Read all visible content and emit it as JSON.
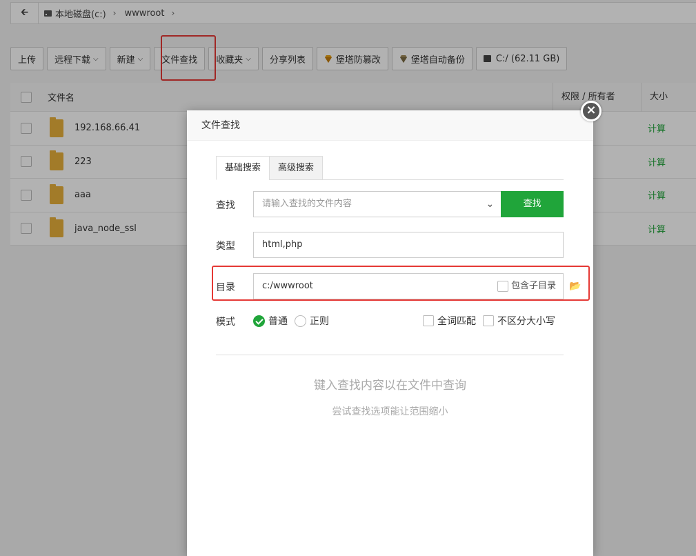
{
  "pathbar": {
    "back_icon": "arrow-left-icon",
    "crumbs": [
      "本地磁盘(c:)",
      "wwwroot"
    ]
  },
  "toolbar": {
    "upload": "上传",
    "remote_download": "远程下载",
    "new": "新建",
    "file_search": "文件查找",
    "favorites": "收藏夹",
    "share_list": "分享列表",
    "tamper_proof": "堡塔防篡改",
    "auto_backup": "堡塔自动备份",
    "disk": "C:/ (62.11 GB)"
  },
  "file_table": {
    "columns": {
      "name": "文件名",
      "perm": "权限 / 所有者",
      "size": "大小"
    },
    "rows": [
      {
        "name": "192.168.66.41",
        "size": "计算"
      },
      {
        "name": "223",
        "size": "计算"
      },
      {
        "name": "aaa",
        "size": "计算"
      },
      {
        "name": "java_node_ssl",
        "size": "计算"
      }
    ]
  },
  "dialog": {
    "title": "文件查找",
    "tabs": [
      "基础搜索",
      "高级搜索"
    ],
    "search_label": "查找",
    "search_placeholder": "请输入查找的文件内容",
    "search_button": "查找",
    "type_label": "类型",
    "type_value": "html,php",
    "dir_label": "目录",
    "dir_value": "c:/wwwroot",
    "subdir_label": "包含子目录",
    "mode_label": "模式",
    "mode_normal": "普通",
    "mode_regex": "正则",
    "whole_word": "全词匹配",
    "ignore_case": "不区分大小写",
    "hint_main": "键入查找内容以在文件中查询",
    "hint_sub": "尝试查找选项能让范围缩小"
  },
  "colors": {
    "accent_green": "#20a53a",
    "highlight_red": "#e53935"
  }
}
